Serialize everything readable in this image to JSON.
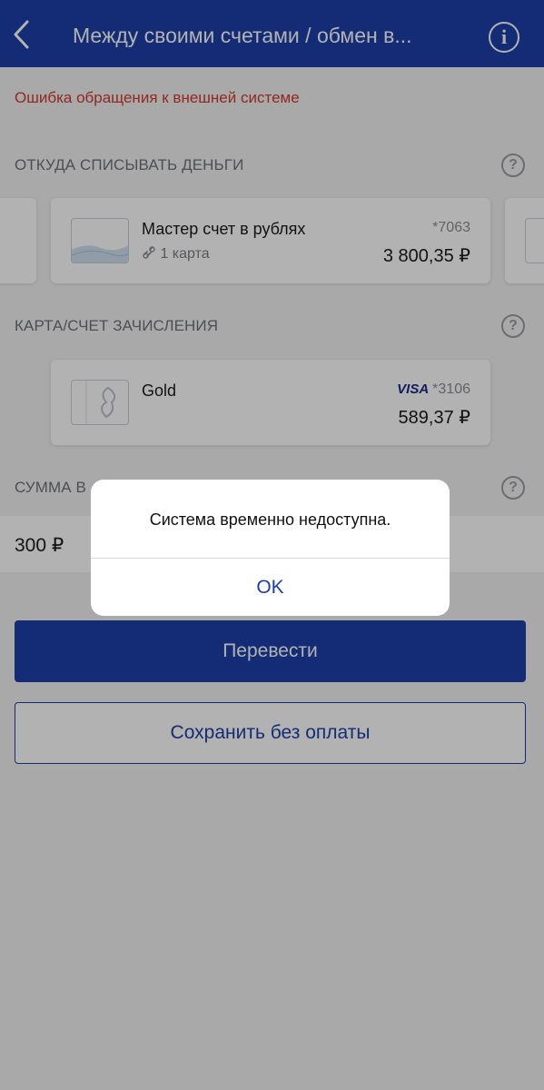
{
  "header": {
    "title": "Между своими счетами / обмен в...",
    "info_glyph": "i",
    "back_icon": "chevron-left-icon",
    "info_icon": "info-circle-icon"
  },
  "error_text": "Ошибка обращения к внешней системе",
  "sections": {
    "from_label": "ОТКУДА СПИСЫВАТЬ ДЕНЬГИ",
    "to_label": "КАРТА/СЧЕТ ЗАЧИСЛЕНИЯ",
    "amount_label": "СУММА В",
    "help_glyph": "?"
  },
  "from_account": {
    "name": "Мастер счет в рублях",
    "linked_cards": "1 карта",
    "number": "*7063",
    "balance": "3 800,35 ₽"
  },
  "to_card": {
    "name": "Gold",
    "brand": "VISA",
    "number": "*3106",
    "balance": "589,37 ₽"
  },
  "amount_value": "300 ₽",
  "buttons": {
    "transfer": "Перевести",
    "save_without_payment": "Сохранить без оплаты"
  },
  "dialog": {
    "message": "Система временно недоступна.",
    "ok": "OK"
  },
  "colors": {
    "brand_blue": "#1c3fa8",
    "error_red": "#d13a2e"
  }
}
